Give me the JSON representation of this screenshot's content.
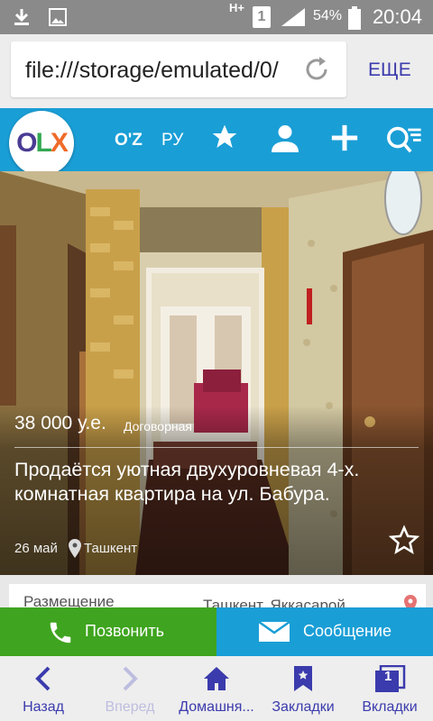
{
  "status_bar": {
    "network_type": "H+",
    "sim_slot": "1",
    "battery_percent": "54%",
    "time": "20:04"
  },
  "browser": {
    "url": "file:///storage/emulated/0/",
    "more_label": "ЕЩЕ"
  },
  "header": {
    "logo": "OLX",
    "lang_uz": "O'Z",
    "lang_ru": "РУ"
  },
  "listing": {
    "price": "38 000 у.е.",
    "price_note": "Договорная",
    "title": "Продаётся уютная двухуровневая 4-х. комнатная квартира на ул. Бабура.",
    "date": "26 май",
    "city": "Ташкент"
  },
  "info": {
    "label": "Размещение",
    "value": "Ташкент, Яккасарой..."
  },
  "actions": {
    "call_label": "Позвонить",
    "message_label": "Сообщение"
  },
  "bottom_nav": {
    "back": "Назад",
    "forward": "Вперед",
    "home": "Домашня...",
    "bookmarks": "Закладки",
    "tabs": "Вкладки",
    "tab_count": "1"
  },
  "colors": {
    "olx_blue": "#1a9ed6",
    "call_green": "#3fa41f",
    "nav_text": "#3b3bad"
  }
}
